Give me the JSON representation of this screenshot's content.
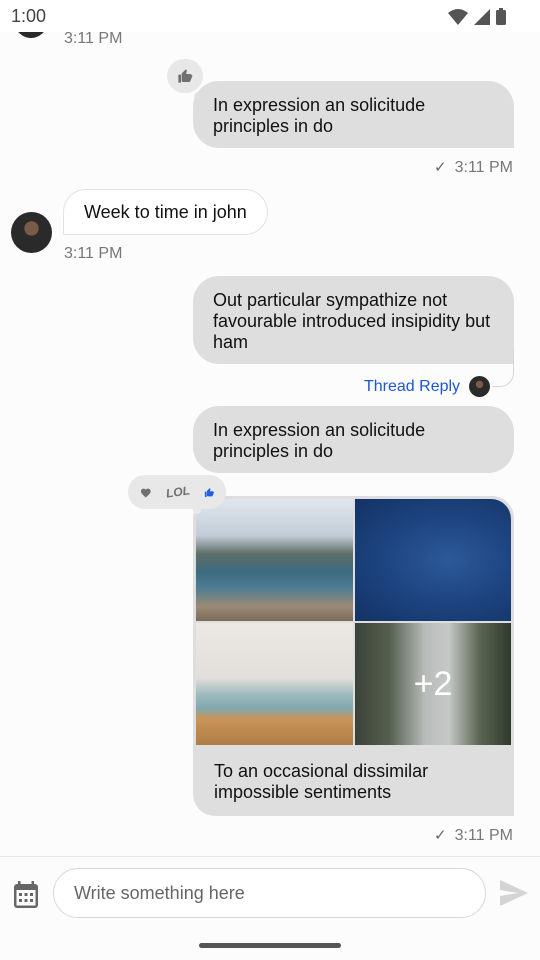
{
  "status_bar": {
    "time": "1:00",
    "icons": [
      "wifi-icon",
      "cellular-signal-icon",
      "battery-icon"
    ]
  },
  "messages": [
    {
      "id": "m0",
      "direction": "incoming",
      "partial": true,
      "timestamp": "3:11 PM"
    },
    {
      "id": "m1",
      "direction": "outgoing",
      "text": "In expression an solicitude principles in do",
      "reaction": "thumbs-up",
      "timestamp": "3:11 PM",
      "status": "sent"
    },
    {
      "id": "m2",
      "direction": "incoming",
      "text": "Week to time in john",
      "timestamp": "3:11 PM"
    },
    {
      "id": "m3",
      "direction": "outgoing",
      "text": "Out particular sympathize not favourable introduced insipidity but ham",
      "thread_reply_label": "Thread Reply"
    },
    {
      "id": "m4",
      "direction": "outgoing",
      "text": "In expression an solicitude principles in do"
    },
    {
      "id": "m5",
      "direction": "outgoing",
      "reactions": [
        {
          "icon": "heart-icon",
          "active": false
        },
        {
          "icon": "lol-icon",
          "label": "LOL",
          "active": false
        },
        {
          "icon": "thumbs-up-icon",
          "active": true
        }
      ],
      "attachments": [
        {
          "name": "fjord-photo"
        },
        {
          "name": "ocean-photo"
        },
        {
          "name": "pier-photo"
        },
        {
          "name": "trees-photo",
          "overlay": "+2"
        }
      ],
      "text": "To an occasional dissimilar impossible sentiments",
      "timestamp": "3:11 PM",
      "status": "sent"
    }
  ],
  "composer": {
    "placeholder": "Write something here",
    "value": ""
  },
  "colors": {
    "accent": "#1b56d8",
    "outgoing_bubble": "#dedede",
    "incoming_bubble": "#ffffff",
    "active_reaction": "#1f5fe0",
    "inactive_reaction": "#707070"
  }
}
